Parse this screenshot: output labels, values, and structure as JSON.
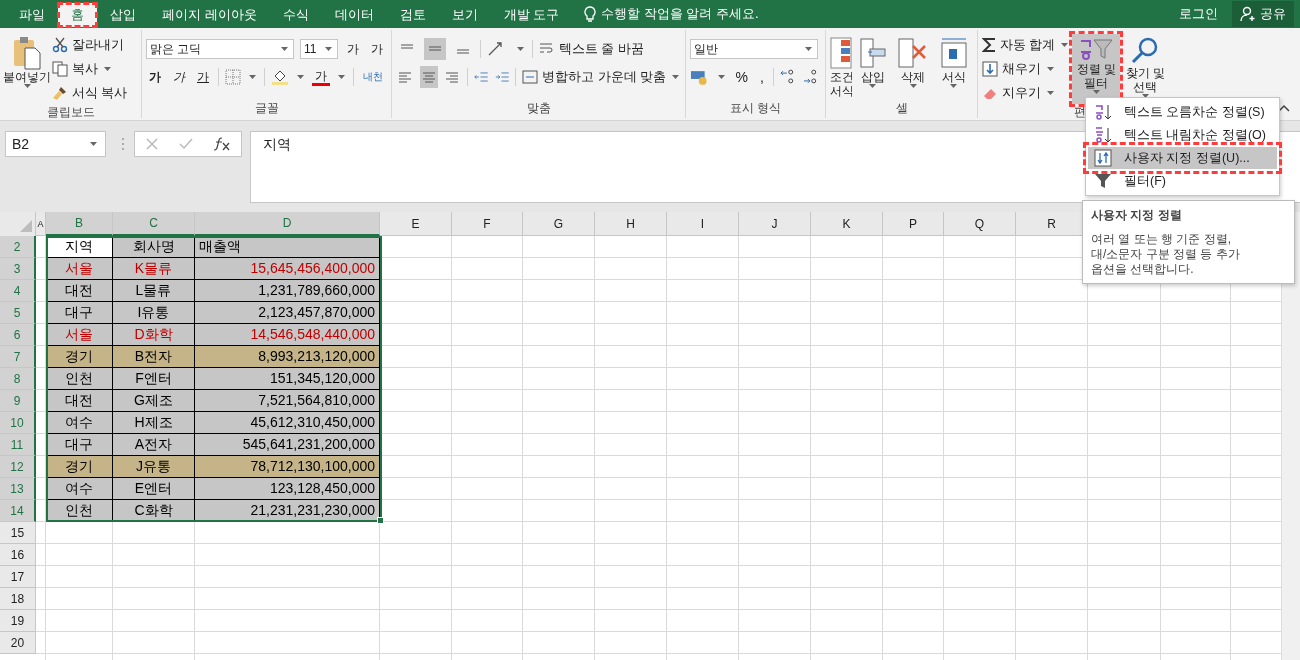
{
  "tabs": [
    {
      "label": "파일",
      "selected": false,
      "annotated": false
    },
    {
      "label": "홈",
      "selected": true,
      "annotated": true
    },
    {
      "label": "삽입",
      "selected": false,
      "annotated": false
    },
    {
      "label": "페이지 레이아웃",
      "selected": false,
      "annotated": false
    },
    {
      "label": "수식",
      "selected": false,
      "annotated": false
    },
    {
      "label": "데이터",
      "selected": false,
      "annotated": false
    },
    {
      "label": "검토",
      "selected": false,
      "annotated": false
    },
    {
      "label": "보기",
      "selected": false,
      "annotated": false
    },
    {
      "label": "개발 도구",
      "selected": false,
      "annotated": false
    }
  ],
  "tell_me": "수행할 작업을 알려 주세요.",
  "login": "로그인",
  "share": "공유",
  "clipboard": {
    "paste": "붙여넣기",
    "cut": "잘라내기",
    "copy": "복사",
    "format_painter": "서식 복사",
    "label": "클립보드"
  },
  "font": {
    "name": "맑은 고딕",
    "size": "11",
    "grow": "가",
    "shrink": "가",
    "bold": "가",
    "italic": "가",
    "underline": "가",
    "text_color": "가",
    "phonetic": "내천",
    "label": "글꼴"
  },
  "alignment": {
    "vertical": [
      {
        "selected": false
      },
      {
        "selected": true
      },
      {
        "selected": false
      }
    ],
    "horizontal": [
      {
        "selected": false
      },
      {
        "selected": true
      },
      {
        "selected": false
      }
    ],
    "wrap": "텍스트 줄 바꿈",
    "merge": "병합하고 가운데 맞춤",
    "label": "맞춤"
  },
  "number": {
    "format": "일반",
    "percent": "%",
    "comma": ",",
    "label": "표시 형식"
  },
  "cells": {
    "conditional": "조건 서식",
    "insert": "삽입",
    "delete": "삭제",
    "format": "서식",
    "label": "셀"
  },
  "editing": {
    "autosum": "자동 합계",
    "fill": "채우기",
    "clear": "지우기",
    "sort_filter": {
      "label": "정렬 및 필터",
      "annotated": true
    },
    "find": "찾기 및 선택",
    "label": "편"
  },
  "formula_bar": {
    "name_box": "B2",
    "content": "지역"
  },
  "sheet": {
    "columns": [
      {
        "label": "A",
        "selected": false
      },
      {
        "label": "B",
        "selected": true
      },
      {
        "label": "C",
        "selected": true
      },
      {
        "label": "D",
        "selected": true
      },
      {
        "label": "E",
        "selected": false
      },
      {
        "label": "F",
        "selected": false
      },
      {
        "label": "G",
        "selected": false
      },
      {
        "label": "H",
        "selected": false
      },
      {
        "label": "I",
        "selected": false
      },
      {
        "label": "J",
        "selected": false
      },
      {
        "label": "K",
        "selected": false
      },
      {
        "label": "P",
        "selected": false
      },
      {
        "label": "Q",
        "selected": false
      },
      {
        "label": "R",
        "selected": false
      }
    ],
    "rows": [
      {
        "number": "2",
        "selected": true,
        "kind": "header",
        "highlighted": false,
        "color": "#000000",
        "cells": [
          {
            "text": "지역",
            "active": true
          },
          {
            "text": "회사명",
            "active": false
          },
          {
            "text": "매출액",
            "active": false
          }
        ]
      },
      {
        "number": "3",
        "selected": true,
        "kind": "data",
        "highlighted": false,
        "color": "#c00000",
        "cells": [
          {
            "text": "서울",
            "active": false
          },
          {
            "text": "K물류",
            "active": false
          },
          {
            "text": "15,645,456,400,000",
            "active": false
          }
        ]
      },
      {
        "number": "4",
        "selected": true,
        "kind": "data",
        "highlighted": false,
        "color": "#000000",
        "cells": [
          {
            "text": "대전",
            "active": false
          },
          {
            "text": "L물류",
            "active": false
          },
          {
            "text": "1,231,789,660,000",
            "active": false
          }
        ]
      },
      {
        "number": "5",
        "selected": true,
        "kind": "data",
        "highlighted": false,
        "color": "#000000",
        "cells": [
          {
            "text": "대구",
            "active": false
          },
          {
            "text": "I유통",
            "active": false
          },
          {
            "text": "2,123,457,870,000",
            "active": false
          }
        ]
      },
      {
        "number": "6",
        "selected": true,
        "kind": "data",
        "highlighted": false,
        "color": "#c00000",
        "cells": [
          {
            "text": "서울",
            "active": false
          },
          {
            "text": "D화학",
            "active": false
          },
          {
            "text": "14,546,548,440,000",
            "active": false
          }
        ]
      },
      {
        "number": "7",
        "selected": true,
        "kind": "data",
        "highlighted": true,
        "color": "#000000",
        "cells": [
          {
            "text": "경기",
            "active": false
          },
          {
            "text": "B전자",
            "active": false
          },
          {
            "text": "8,993,213,120,000",
            "active": false
          }
        ]
      },
      {
        "number": "8",
        "selected": true,
        "kind": "data",
        "highlighted": false,
        "color": "#000000",
        "cells": [
          {
            "text": "인천",
            "active": false
          },
          {
            "text": "F엔터",
            "active": false
          },
          {
            "text": "151,345,120,000",
            "active": false
          }
        ]
      },
      {
        "number": "9",
        "selected": true,
        "kind": "data",
        "highlighted": false,
        "color": "#000000",
        "cells": [
          {
            "text": "대전",
            "active": false
          },
          {
            "text": "G제조",
            "active": false
          },
          {
            "text": "7,521,564,810,000",
            "active": false
          }
        ]
      },
      {
        "number": "10",
        "selected": true,
        "kind": "data",
        "highlighted": false,
        "color": "#000000",
        "cells": [
          {
            "text": "여수",
            "active": false
          },
          {
            "text": "H제조",
            "active": false
          },
          {
            "text": "45,612,310,450,000",
            "active": false
          }
        ]
      },
      {
        "number": "11",
        "selected": true,
        "kind": "data",
        "highlighted": false,
        "color": "#000000",
        "cells": [
          {
            "text": "대구",
            "active": false
          },
          {
            "text": "A전자",
            "active": false
          },
          {
            "text": "545,641,231,200,000",
            "active": false
          }
        ]
      },
      {
        "number": "12",
        "selected": true,
        "kind": "data",
        "highlighted": true,
        "color": "#000000",
        "cells": [
          {
            "text": "경기",
            "active": false
          },
          {
            "text": "J유통",
            "active": false
          },
          {
            "text": "78,712,130,100,000",
            "active": false
          }
        ]
      },
      {
        "number": "13",
        "selected": true,
        "kind": "data",
        "highlighted": false,
        "color": "#000000",
        "cells": [
          {
            "text": "여수",
            "active": false
          },
          {
            "text": "E엔터",
            "active": false
          },
          {
            "text": "123,128,450,000",
            "active": false
          }
        ]
      },
      {
        "number": "14",
        "selected": true,
        "kind": "data",
        "highlighted": false,
        "color": "#000000",
        "cells": [
          {
            "text": "인천",
            "active": false
          },
          {
            "text": "C화학",
            "active": false
          },
          {
            "text": "21,231,231,230,000",
            "active": false
          }
        ]
      },
      {
        "number": "15",
        "selected": false,
        "kind": "empty"
      },
      {
        "number": "16",
        "selected": false,
        "kind": "empty"
      },
      {
        "number": "17",
        "selected": false,
        "kind": "empty"
      },
      {
        "number": "18",
        "selected": false,
        "kind": "empty"
      },
      {
        "number": "19",
        "selected": false,
        "kind": "empty"
      },
      {
        "number": "20",
        "selected": false,
        "kind": "empty"
      }
    ]
  },
  "sort_menu": {
    "items": [
      {
        "label": "텍스트 오름차순 정렬(S)",
        "kind": "ascending",
        "selected": false,
        "annotated": false
      },
      {
        "label": "텍스트 내림차순 정렬(O)",
        "kind": "descending",
        "selected": false,
        "annotated": false
      },
      {
        "label": "사용자 지정 정렬(U)...",
        "kind": "custom",
        "selected": true,
        "annotated": true
      },
      {
        "label": "필터(F)",
        "kind": "filter",
        "selected": false,
        "annotated": false
      }
    ]
  },
  "tooltip": {
    "title": "사용자 지정 정렬",
    "lines": [
      "여러 열 또는 행 기준 정렬,",
      "대/소문자 구분 정렬 등 추가",
      "옵션을 선택합니다."
    ]
  }
}
